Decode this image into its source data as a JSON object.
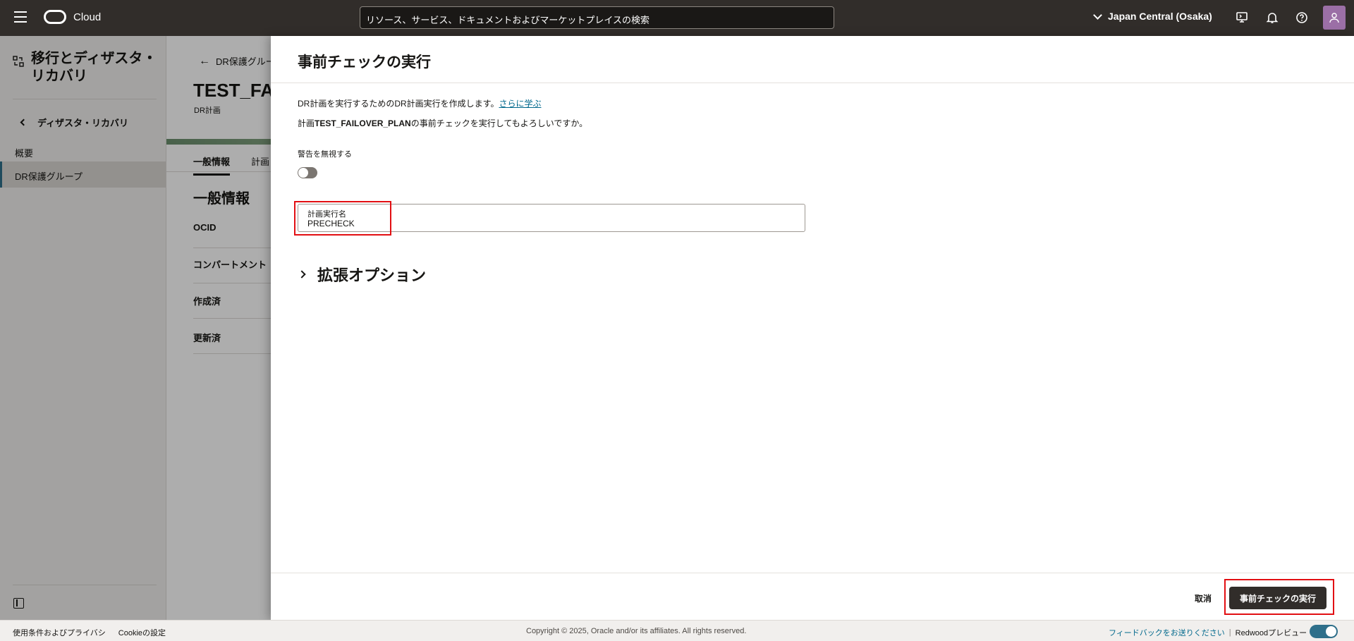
{
  "header": {
    "brand": "Cloud",
    "search_placeholder": "リソース、サービス、ドキュメントおよびマーケットプレイスの検索",
    "region": "Japan Central (Osaka)"
  },
  "sidebar": {
    "title": "移行とディザスタ・リカバリ",
    "back_label": "ディザスタ・リカバリ",
    "items": [
      {
        "label": "概要"
      },
      {
        "label": "DR保護グループ"
      }
    ]
  },
  "page": {
    "breadcrumb": "DR保護グルー",
    "title": "TEST_FAI",
    "subtitle": "DR計画",
    "tabs": [
      "一般情報",
      "計画"
    ],
    "section_title": "一般情報",
    "fields": [
      "OCID",
      "コンパートメント",
      "作成済",
      "更新済"
    ]
  },
  "drawer": {
    "title": "事前チェックの実行",
    "intro_text": "DR計画を実行するためのDR計画実行を作成します。",
    "learn_more": "さらに学ぶ",
    "confirm_prefix": "計画",
    "confirm_plan": "TEST_FAILOVER_PLAN",
    "confirm_suffix": "の事前チェックを実行してもよろしいですか。",
    "ignore_warnings_label": "警告を無視する",
    "ignore_warnings_on": false,
    "plan_execution_label": "計画実行名",
    "plan_execution_value": "PRECHECK",
    "advanced_options": "拡張オプション",
    "cancel_label": "取消",
    "run_label": "事前チェックの実行"
  },
  "footer": {
    "terms": "使用条件およびプライバシ",
    "cookies": "Cookieの設定",
    "copyright": "Copyright © 2025, Oracle and/or its affiliates. All rights reserved.",
    "feedback": "フィードバックをお送りください",
    "redwood": "Redwoodプレビュー",
    "redwood_on": true
  },
  "colors": {
    "header_bg": "#312d2a",
    "link": "#00688c",
    "highlight": "#e20f13",
    "primary_button": "#312d2a"
  }
}
